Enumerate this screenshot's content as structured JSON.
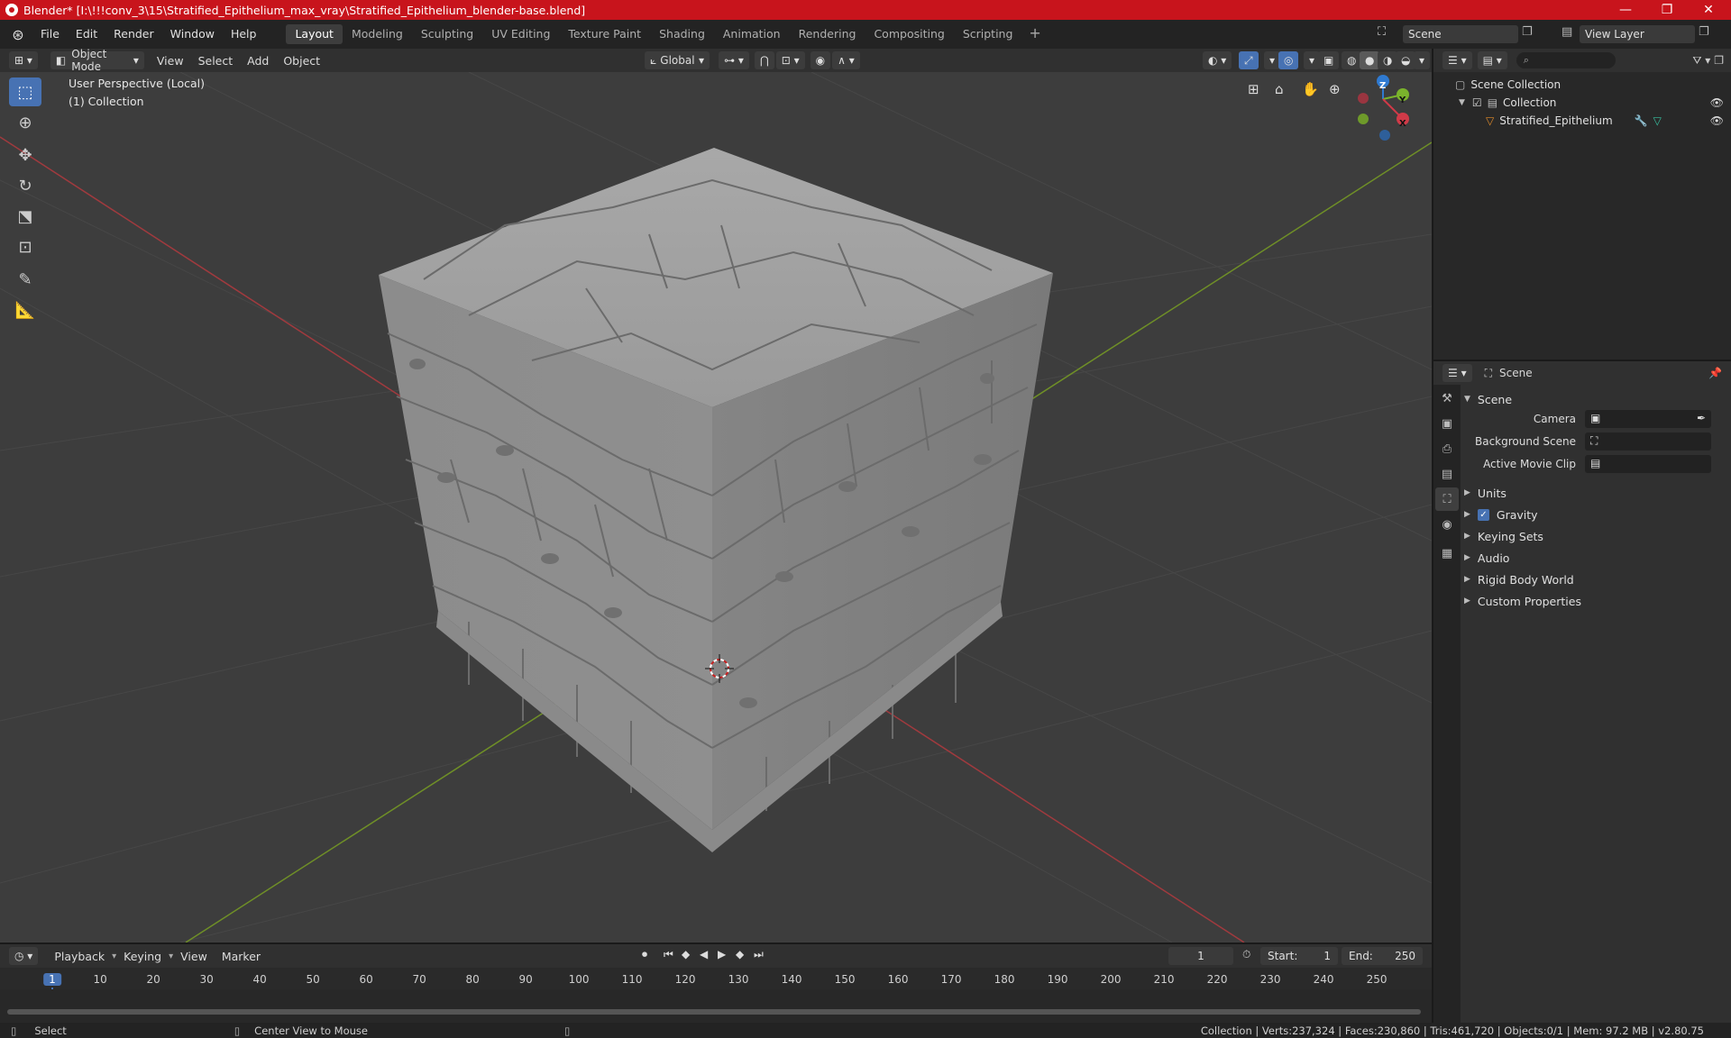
{
  "window": {
    "title": "Blender* [I:\\!!!conv_3\\15\\Stratified_Epithelium_max_vray\\Stratified_Epithelium_blender-base.blend]",
    "minimize": "—",
    "maximize": "❐",
    "close": "✕"
  },
  "menubar": {
    "items": [
      "File",
      "Edit",
      "Render",
      "Window",
      "Help"
    ],
    "workspaces": [
      "Layout",
      "Modeling",
      "Sculpting",
      "UV Editing",
      "Texture Paint",
      "Shading",
      "Animation",
      "Rendering",
      "Compositing",
      "Scripting"
    ],
    "active_workspace": "Layout",
    "add_workspace": "+",
    "scene_name": "Scene",
    "view_layer": "View Layer"
  },
  "viewport_header": {
    "mode": "Object Mode",
    "menus": [
      "View",
      "Select",
      "Add",
      "Object"
    ],
    "transform_orientation": "Global"
  },
  "viewport": {
    "perspective_label": "User Perspective (Local)",
    "collection_label": "(1) Collection",
    "gizmo_axes": {
      "x": "X",
      "y": "Y",
      "z": "Z"
    },
    "colors": {
      "background": "#3d3d3d",
      "x_axis": "#a03a3e",
      "y_axis": "#6f8f27",
      "grid": "#474747",
      "mesh": "#9a9a9a"
    }
  },
  "outliner": {
    "search_placeholder": "",
    "scene_collection": "Scene Collection",
    "collection": "Collection",
    "object": "Stratified_Epithelium"
  },
  "properties": {
    "context": "Scene",
    "panel_title": "Scene",
    "camera_label": "Camera",
    "background_scene_label": "Background Scene",
    "active_movie_clip_label": "Active Movie Clip",
    "sections": [
      "Units",
      "Gravity",
      "Keying Sets",
      "Audio",
      "Rigid Body World",
      "Custom Properties"
    ],
    "gravity_enabled": true
  },
  "timeline": {
    "menus": [
      "Playback",
      "Keying",
      "View",
      "Marker"
    ],
    "current_frame": "1",
    "start_label": "Start:",
    "start": "1",
    "end_label": "End:",
    "end": "250",
    "ticks": [
      "1",
      "10",
      "20",
      "30",
      "40",
      "50",
      "60",
      "70",
      "80",
      "90",
      "100",
      "110",
      "120",
      "130",
      "140",
      "150",
      "160",
      "170",
      "180",
      "190",
      "200",
      "210",
      "220",
      "230",
      "240",
      "250"
    ]
  },
  "statusbar": {
    "select": "Select",
    "center_view": "Center View to Mouse",
    "stats": "Collection | Verts:237,324 | Faces:230,860 | Tris:461,720 | Objects:0/1 | Mem: 97.2 MB | v2.80.75"
  }
}
